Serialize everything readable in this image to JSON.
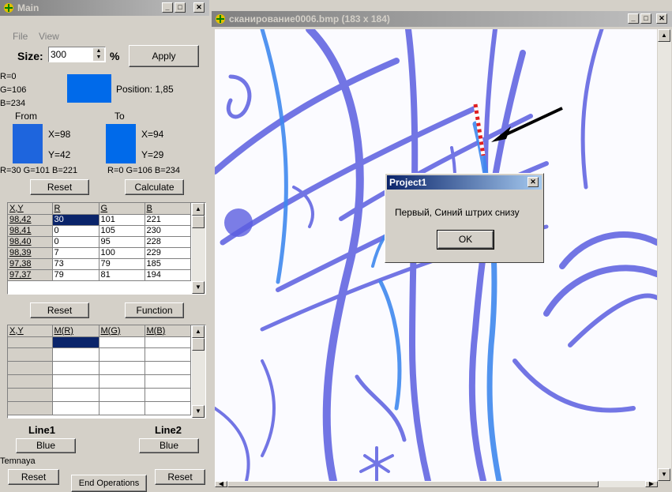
{
  "main_window": {
    "title": "Main",
    "menu": [
      "File",
      "View"
    ],
    "size_label": "Size:",
    "size_value": "300",
    "percent": "%",
    "apply_label": "Apply",
    "rgb": {
      "r": "R=0",
      "g": "G=106",
      "b": "B=234",
      "color": "#006aea"
    },
    "position": "Position: 1,85",
    "from_label": "From",
    "to_label": "To",
    "from": {
      "x": "X=98",
      "y": "Y=42",
      "rgb": "R=30 G=101 B=221",
      "color": "#1e65dd"
    },
    "to": {
      "x": "X=94",
      "y": "Y=29",
      "rgb": "R=0 G=106 B=234",
      "color": "#006aea"
    },
    "reset_label": "Reset",
    "calculate_label": "Calculate",
    "table1": {
      "headers": [
        "X,Y",
        "R",
        "G",
        "B"
      ],
      "rows": [
        [
          "98,42",
          "30",
          "101",
          "221"
        ],
        [
          "98,41",
          "0",
          "105",
          "230"
        ],
        [
          "98,40",
          "0",
          "95",
          "228"
        ],
        [
          "98,39",
          "7",
          "100",
          "229"
        ],
        [
          "97,38",
          "73",
          "79",
          "185"
        ],
        [
          "97,37",
          "79",
          "81",
          "194"
        ]
      ]
    },
    "reset2_label": "Reset",
    "function_label": "Function",
    "table2": {
      "headers": [
        "X,Y",
        "M(R)",
        "M(G)",
        "M(B)"
      ]
    },
    "line1": "Line1",
    "line2": "Line2",
    "blue1": "Blue",
    "blue2": "Blue",
    "temnaya": "Temnaya",
    "reset3_label": "Reset",
    "reset4_label": "Reset",
    "end_ops_label": "End Operations"
  },
  "image_window": {
    "title": "сканирование0006.bmp (183 x 184)"
  },
  "dialog": {
    "title": "Project1",
    "message": "Первый, Синий штрих снизу",
    "ok_label": "OK"
  },
  "colors": {
    "ink": "#5b5ee0",
    "ink_light": "#3f88ee",
    "title_active": "#0a246a"
  }
}
